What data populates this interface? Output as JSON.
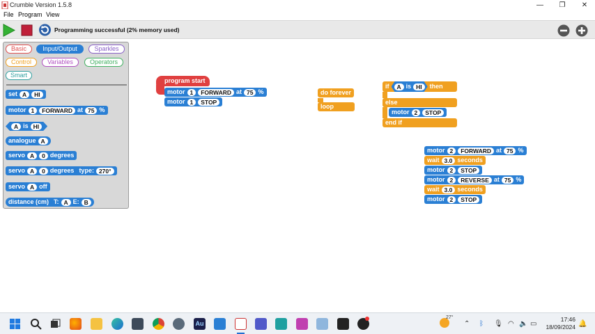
{
  "window": {
    "title": "Crumble Version 1.5.8",
    "min": "—",
    "restore": "❐",
    "close": "✕"
  },
  "menu": [
    "File",
    "Program",
    "View"
  ],
  "toolbar": {
    "status": "Programming successful (2% memory used)"
  },
  "palette": {
    "categories": [
      {
        "label": "Basic",
        "color": "#e05050"
      },
      {
        "label": "Input/Output",
        "color": "#2a7fd4"
      },
      {
        "label": "Sparkles",
        "color": "#8a60c8"
      },
      {
        "label": "Control",
        "color": "#f0a020"
      },
      {
        "label": "Variables",
        "color": "#b050c0"
      },
      {
        "label": "Operators",
        "color": "#40b060"
      },
      {
        "label": "Smart",
        "color": "#30a0a0"
      }
    ],
    "blocks": {
      "set": {
        "label": "set",
        "var": "A",
        "val": "HI"
      },
      "motor": {
        "label": "motor",
        "num": "1",
        "dir": "FORWARD",
        "at": "at",
        "speed": "75",
        "pct": "%"
      },
      "compare": {
        "var": "A",
        "is": "is",
        "val": "HI"
      },
      "analogue": {
        "label": "analogue",
        "pin": "A"
      },
      "servo": {
        "label": "servo",
        "pin": "A",
        "val": "0",
        "unit": "degrees"
      },
      "servo_type": {
        "label": "servo",
        "pin": "A",
        "val": "0",
        "unit": "degrees",
        "type": "type:",
        "typeval": "270°"
      },
      "servo_off": {
        "label": "servo",
        "pin": "A",
        "off": "off"
      },
      "distance": {
        "label": "distance (cm)",
        "t": "T:",
        "tv": "A",
        "e": "E:",
        "ev": "B"
      }
    }
  },
  "canvas": {
    "program_start": "program start",
    "s1": {
      "label": "motor",
      "num": "1",
      "dir": "FORWARD",
      "at": "at",
      "speed": "75",
      "pct": "%"
    },
    "s2": {
      "label": "motor",
      "num": "1",
      "dir": "STOP"
    },
    "do_forever": "do forever",
    "loop": "loop",
    "if": {
      "if": "if",
      "var": "A",
      "is": "is",
      "val": "HI",
      "then": "then",
      "else": "else",
      "endif": "end if"
    },
    "if_motor": {
      "label": "motor",
      "num": "2",
      "dir": "STOP"
    },
    "seq": [
      {
        "kind": "motor",
        "label": "motor",
        "num": "2",
        "dir": "FORWARD",
        "at": "at",
        "speed": "75",
        "pct": "%"
      },
      {
        "kind": "wait",
        "label": "wait",
        "val": "3.0",
        "unit": "seconds"
      },
      {
        "kind": "motor",
        "label": "motor",
        "num": "2",
        "dir": "STOP"
      },
      {
        "kind": "motor",
        "label": "motor",
        "num": "2",
        "dir": "REVERSE",
        "at": "at",
        "speed": "75",
        "pct": "%"
      },
      {
        "kind": "wait",
        "label": "wait",
        "val": "3.0",
        "unit": "seconds"
      },
      {
        "kind": "motor",
        "label": "motor",
        "num": "2",
        "dir": "STOP"
      }
    ]
  },
  "taskbar": {
    "weather": "27°",
    "time": "17:46",
    "date": "18/09/2024",
    "apps": [
      "start-icon",
      "search-icon",
      "task-view-icon",
      "firefox-icon",
      "file-explorer-icon",
      "edge-icon",
      "app-icon",
      "chrome-icon",
      "settings-icon",
      "audition-icon",
      "vscode-icon",
      "crumble-icon",
      "teams-icon",
      "app-icon-2",
      "app-icon-3",
      "app-icon-4",
      "app-icon-5",
      "app-icon-6"
    ]
  }
}
